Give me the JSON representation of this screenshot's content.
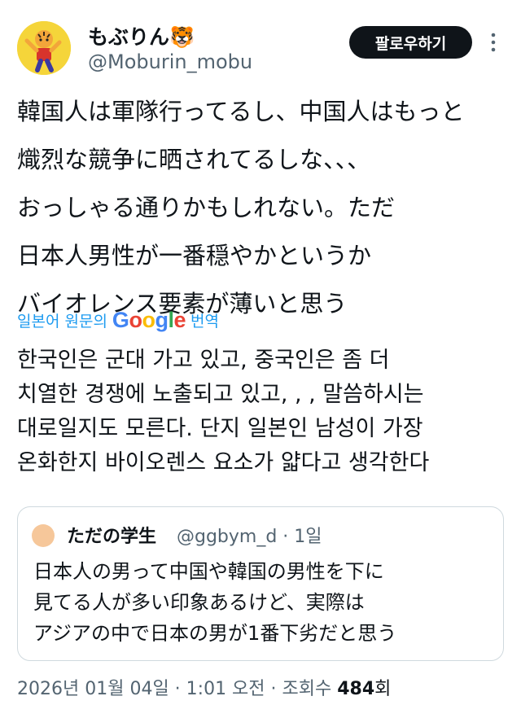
{
  "author": {
    "display_name": "もぶりん🐯",
    "handle": "@Moburin_mobu"
  },
  "follow_button_label": "팔로우하기",
  "tweet_lines": [
    "韓国人は軍隊行ってるし、中国人はもっと",
    "熾烈な競争に晒されてるしな、、、",
    "おっしゃる通りかもしれない。ただ",
    "日本人男性が一番穏やかというか",
    "バイオレンス要素が薄いと思う"
  ],
  "translation": {
    "prefix": "일본어 원문의",
    "google_letters": [
      "G",
      "o",
      "o",
      "g",
      "l",
      "e"
    ],
    "suffix": "번역",
    "lines": [
      "한국인은 군대 가고 있고, 중국인은 좀 더",
      "치열한 경쟁에 노출되고 있고, , , 말씀하시는",
      "대로일지도 모른다. 단지 일본인 남성이 가장",
      "온화한지 바이오렌스 요소가 얇다고 생각한다"
    ]
  },
  "quote": {
    "name": "ただの学生",
    "meta": "@ggbym_d · 1일",
    "lines": [
      "日本人の男って中国や韓国の男性を下に",
      "見てる人が多い印象あるけど、実際は",
      "アジアの中で日本の男が1番下劣だと思う"
    ]
  },
  "footer": {
    "timestamp": "2026년 01월 04일 · 1:01 오전 · 조회수 ",
    "views": "484",
    "views_unit": "회"
  },
  "colors": {
    "text": "#0f1419",
    "secondary": "#536471",
    "link_blue": "#1d9bf0",
    "button_bg": "#0f1419",
    "google": [
      "#4285f4",
      "#ea4335",
      "#fbbc05",
      "#4285f4",
      "#34a853",
      "#ea4335"
    ]
  }
}
